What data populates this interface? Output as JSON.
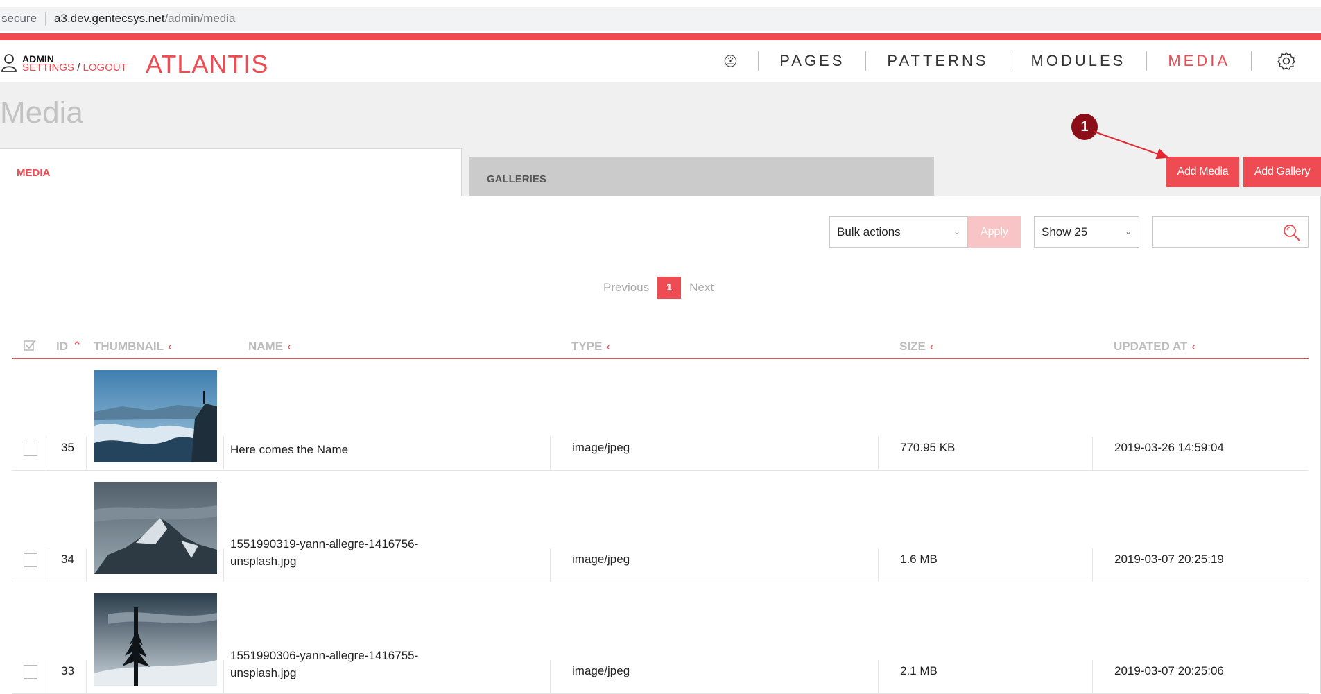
{
  "browser": {
    "secure_label": "secure",
    "url_host": "a3.dev.gentecsys.net",
    "url_path": "/admin/media"
  },
  "header": {
    "admin_label": "ADMIN",
    "settings_label": "SETTINGS",
    "separator": "/",
    "logout_label": "LOGOUT",
    "brand": "ATLANTIS",
    "nav": [
      {
        "label": "PAGES",
        "active": false
      },
      {
        "label": "PATTERNS",
        "active": false
      },
      {
        "label": "MODULES",
        "active": false
      },
      {
        "label": "MEDIA",
        "active": true
      }
    ],
    "icons": {
      "dashboard": "speedometer-icon",
      "settings": "gear-icon",
      "user": "user-icon"
    }
  },
  "page": {
    "title": "Media",
    "tabs": [
      {
        "label": "MEDIA",
        "active": true
      },
      {
        "label": "GALLERIES",
        "active": false
      }
    ],
    "add_media_label": "Add Media",
    "add_gallery_label": "Add Gallery",
    "annotation_marker": "1"
  },
  "toolbar": {
    "bulk_select_value": "Bulk actions",
    "apply_label": "Apply",
    "show_select_value": "Show 25",
    "search_placeholder": ""
  },
  "pagination": {
    "previous_label": "Previous",
    "current_page": "1",
    "next_label": "Next"
  },
  "table": {
    "columns": {
      "id": "ID",
      "thumbnail": "THUMBNAIL",
      "name": "NAME",
      "type": "TYPE",
      "size": "SIZE",
      "updated_at": "UPDATED AT"
    },
    "rows": [
      {
        "id": "35",
        "name": "Here comes the Name",
        "type": "image/jpeg",
        "size": "770.95 KB",
        "updated_at": "2019-03-26 14:59:04"
      },
      {
        "id": "34",
        "name_line1": "1551990319-yann-allegre-1416756-",
        "name_line2": "unsplash.jpg",
        "type": "image/jpeg",
        "size": "1.6 MB",
        "updated_at": "2019-03-07 20:25:19"
      },
      {
        "id": "33",
        "name_line1": "1551990306-yann-allegre-1416755-",
        "name_line2": "unsplash.jpg",
        "type": "image/jpeg",
        "size": "2.1 MB",
        "updated_at": "2019-03-07 20:25:06"
      }
    ]
  },
  "colors": {
    "accent": "#ef4b52",
    "marker": "#8b0d17",
    "apply_disabled": "#f9c4c6"
  }
}
